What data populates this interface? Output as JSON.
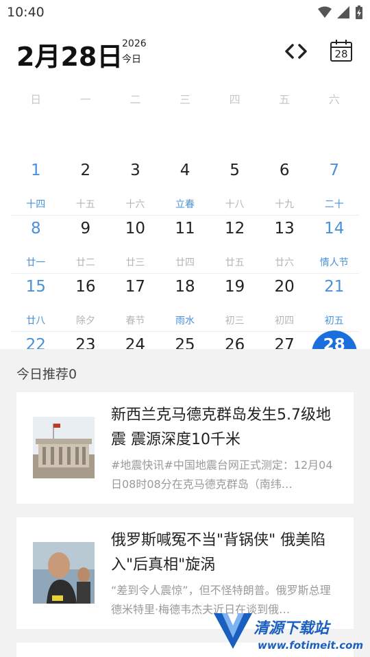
{
  "status": {
    "time": "10:40"
  },
  "header": {
    "big_date": "2月28日",
    "year": "2026",
    "today_label": "今日",
    "calendar_icon_day": "28"
  },
  "weekdays": [
    "日",
    "一",
    "二",
    "三",
    "四",
    "五",
    "六"
  ],
  "calendar": {
    "accent_color": "#4a90d9",
    "selected_color": "#1a6fdc",
    "weeks": [
      [
        {
          "day": "1",
          "lunar": "十四",
          "lunar_hl": true,
          "weekend": true
        },
        {
          "day": "2",
          "lunar": "十五"
        },
        {
          "day": "3",
          "lunar": "十六"
        },
        {
          "day": "4",
          "lunar": "立春",
          "lunar_hl": true
        },
        {
          "day": "5",
          "lunar": "十八"
        },
        {
          "day": "6",
          "lunar": "十九"
        },
        {
          "day": "7",
          "lunar": "二十",
          "lunar_hl": true,
          "weekend": true
        }
      ],
      [
        {
          "day": "8",
          "lunar": "廿一",
          "lunar_hl": true,
          "weekend": true
        },
        {
          "day": "9",
          "lunar": "廿二"
        },
        {
          "day": "10",
          "lunar": "廿三"
        },
        {
          "day": "11",
          "lunar": "廿四"
        },
        {
          "day": "12",
          "lunar": "廿五"
        },
        {
          "day": "13",
          "lunar": "廿六"
        },
        {
          "day": "14",
          "lunar": "情人节",
          "lunar_hl": true,
          "weekend": true
        }
      ],
      [
        {
          "day": "15",
          "lunar": "廿八",
          "lunar_hl": true,
          "weekend": true
        },
        {
          "day": "16",
          "lunar": "除夕"
        },
        {
          "day": "17",
          "lunar": "春节"
        },
        {
          "day": "18",
          "lunar": "雨水",
          "lunar_hl": true
        },
        {
          "day": "19",
          "lunar": "初三"
        },
        {
          "day": "20",
          "lunar": "初四"
        },
        {
          "day": "21",
          "lunar": "初五",
          "lunar_hl": true,
          "weekend": true
        }
      ],
      [
        {
          "day": "22",
          "lunar": "",
          "weekend": true
        },
        {
          "day": "23",
          "lunar": ""
        },
        {
          "day": "24",
          "lunar": ""
        },
        {
          "day": "25",
          "lunar": ""
        },
        {
          "day": "26",
          "lunar": ""
        },
        {
          "day": "27",
          "lunar": ""
        },
        {
          "day": "28",
          "lunar": "",
          "weekend": true,
          "selected": true
        }
      ]
    ]
  },
  "feed": {
    "title": "今日推荐0",
    "cards": [
      {
        "title": "新西兰克马德克群岛发生5.7级地震 震源深度10千米",
        "snippet": "#地震快讯#中国地震台网正式测定：12月04日08时08分在克马德克群岛（南纬…",
        "thumb_icon": "building-photo-icon"
      },
      {
        "title": "俄罗斯喊冤不当\"背锅侠\" 俄美陷入\"后真相\"旋涡",
        "snippet": "“差到令人震惊”，但不怪特朗普。俄罗斯总理德米特里·梅德韦杰夫近日在谈到俄…",
        "thumb_icon": "person-photo-icon"
      }
    ]
  },
  "watermark": {
    "name": "清源下载站",
    "url": "www.fotimeit.com"
  }
}
